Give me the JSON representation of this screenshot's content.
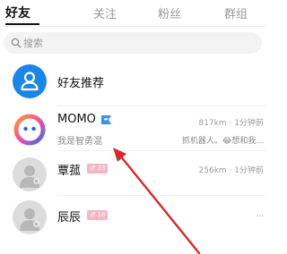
{
  "tabs": [
    {
      "label": "好友",
      "active": true
    },
    {
      "label": "关注",
      "active": false
    },
    {
      "label": "粉丝",
      "active": false
    },
    {
      "label": "群组",
      "active": false
    }
  ],
  "search": {
    "placeholder": "搜索"
  },
  "recommend": {
    "label": "好友推荐"
  },
  "contacts": [
    {
      "name": "MOMO",
      "subtitle": "我是智勇混",
      "meta": "817km · 1分钟前",
      "message": "抓机器人。😂想和我..."
    },
    {
      "name": "覃菰",
      "badge": "♂ 23",
      "meta": "256km · 1分钟前"
    },
    {
      "name": "辰辰",
      "badge": "♂ 18",
      "meta": "..."
    }
  ],
  "colors": {
    "accent": "#1a86e8",
    "badge": "#f7b4c4",
    "arrow": "#d32b2b"
  },
  "icons": [
    "search-icon",
    "user-icon",
    "momo-logo-icon",
    "flag-icon",
    "default-avatar-icon"
  ]
}
